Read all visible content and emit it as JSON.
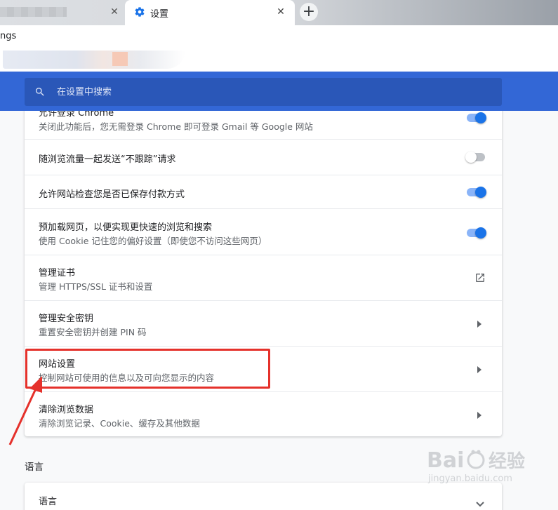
{
  "browser": {
    "active_tab_title": "设置",
    "close_glyph": "✕",
    "new_tab_glyph": "+",
    "address_text": "ngs"
  },
  "header": {
    "search_placeholder": "在设置中搜索"
  },
  "settings_rows": [
    {
      "title": "允许登录 Chrome",
      "subtitle": "关闭此功能后，您无需登录 Chrome 即可登录 Gmail 等 Google 网站",
      "control": "toggle-on"
    },
    {
      "title": "随浏览流量一起发送“不跟踪”请求",
      "subtitle": "",
      "control": "toggle-off"
    },
    {
      "title": "允许网站检查您是否已保存付款方式",
      "subtitle": "",
      "control": "toggle-on"
    },
    {
      "title": "预加载网页，以便实现更快速的浏览和搜索",
      "subtitle": "使用 Cookie 记住您的偏好设置（即使您不访问这些网页）",
      "control": "toggle-on"
    },
    {
      "title": "管理证书",
      "subtitle": "管理 HTTPS/SSL 证书和设置",
      "control": "external-link-icon"
    },
    {
      "title": "管理安全密钥",
      "subtitle": "重置安全密钥并创建 PIN 码",
      "control": "chevron-right-icon"
    },
    {
      "title": "网站设置",
      "subtitle": "控制网站可使用的信息以及可向您显示的内容",
      "control": "chevron-right-icon"
    },
    {
      "title": "清除浏览数据",
      "subtitle": "清除浏览记录、Cookie、缓存及其他数据",
      "control": "chevron-right-icon"
    }
  ],
  "language_section": {
    "section_title": "语言",
    "row_title": "语言"
  },
  "watermark": {
    "brand": "Bai",
    "brand_cn": "经验",
    "url": "jingyan.baidu.com"
  },
  "colors": {
    "header_blue": "#3367d6",
    "toggle_on": "#1a73e8",
    "annotation_red": "#e5312b"
  }
}
